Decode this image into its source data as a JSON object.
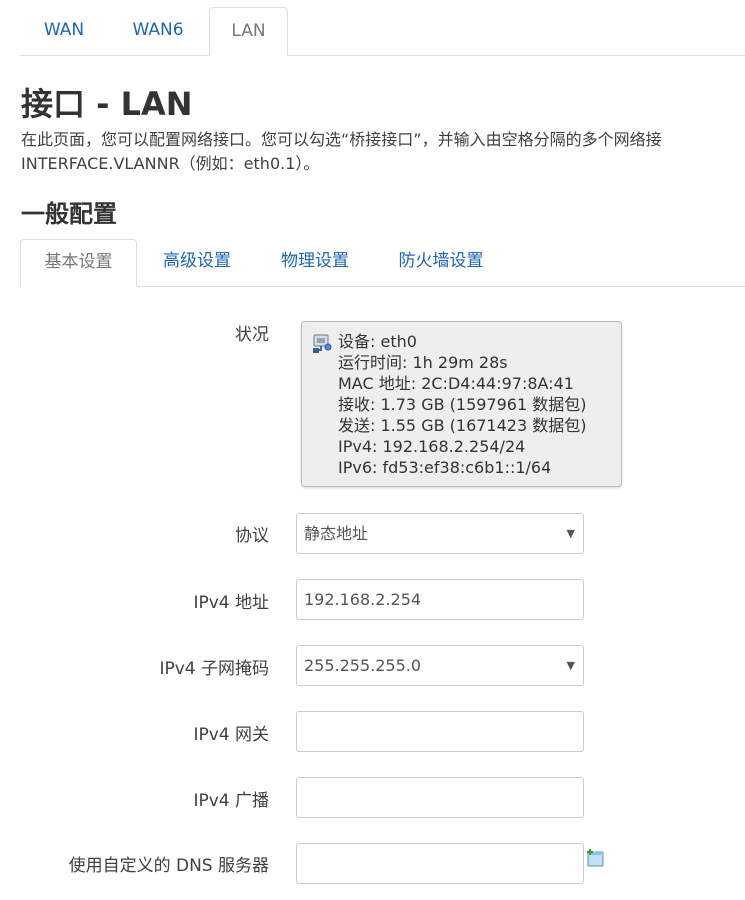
{
  "top_tabs": [
    {
      "label": "WAN"
    },
    {
      "label": "WAN6"
    },
    {
      "label": "LAN"
    }
  ],
  "active_top_tab": "LAN",
  "page": {
    "title": "接口 - LAN",
    "description_line1": "在此页面，您可以配置网络接口。您可以勾选“桥接接口”，并输入由空格分隔的多个网络接",
    "description_line2": "INTERFACE.VLANNR（例如：eth0.1）。"
  },
  "section": {
    "title": "一般配置"
  },
  "sub_tabs": [
    {
      "label": "基本设置"
    },
    {
      "label": "高级设置"
    },
    {
      "label": "物理设置"
    },
    {
      "label": "防火墙设置"
    }
  ],
  "active_sub_tab": "基本设置",
  "form": {
    "status_label": "状况",
    "status": {
      "device": "设备: eth0",
      "uptime": "运行时间: 1h 29m 28s",
      "mac": "MAC 地址: 2C:D4:44:97:8A:41",
      "rx": "接收: 1.73 GB (1597961 数据包)",
      "tx": "发送: 1.55 GB (1671423 数据包)",
      "ipv4": "IPv4: 192.168.2.254/24",
      "ipv6": "IPv6: fd53:ef38:c6b1::1/64"
    },
    "protocol_label": "协议",
    "protocol_value": "静态地址",
    "ipv4_address_label": "IPv4 地址",
    "ipv4_address_value": "192.168.2.254",
    "ipv4_netmask_label": "IPv4 子网掩码",
    "ipv4_netmask_value": "255.255.255.0",
    "ipv4_gateway_label": "IPv4 网关",
    "ipv4_gateway_value": "",
    "ipv4_broadcast_label": "IPv4 广播",
    "ipv4_broadcast_value": "",
    "dns_label": "使用自定义的 DNS 服务器",
    "dns_value": ""
  },
  "icons": {
    "status": "network-port-icon",
    "add": "add-entry-icon",
    "dropdown": "caret-down-icon"
  },
  "colors": {
    "link": "#1d66b7",
    "active_tab_text": "#777777",
    "border": "#dddddd",
    "status_bg": "#eeeeee"
  }
}
